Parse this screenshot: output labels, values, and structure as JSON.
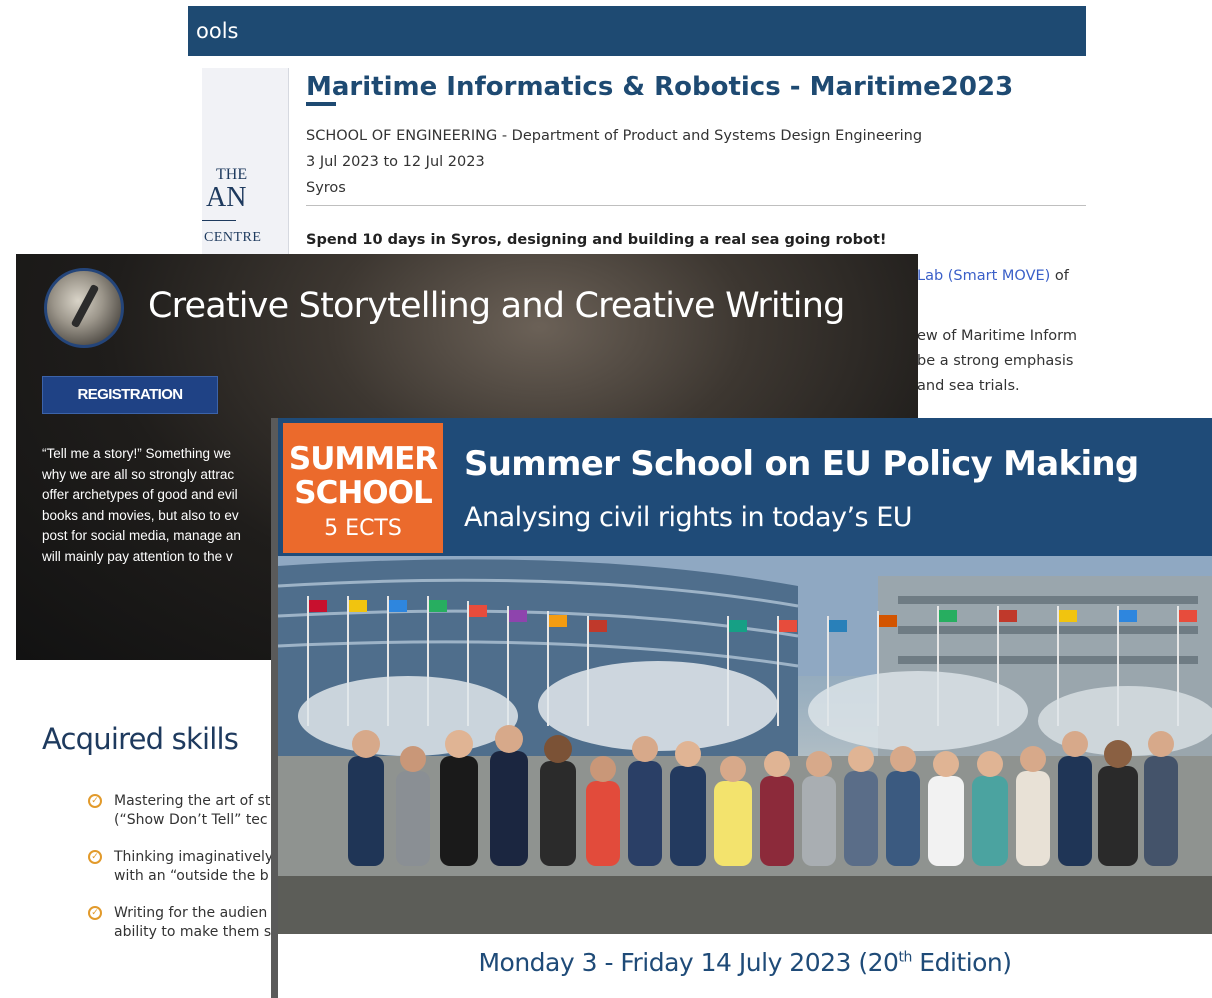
{
  "maritime": {
    "header_fragment": "ools",
    "logo": {
      "the": "THE",
      "an": "AN",
      "centre": "CENTRE"
    },
    "title": "Maritime Informatics & Robotics - Maritime2023",
    "school": "SCHOOL OF ENGINEERING - Department of Product and Systems Design Engineering",
    "dates": "3 Jul 2023 to 12 Jul 2023",
    "location": "Syros",
    "lead": "Spend 10 days in Syros, designing and building a real sea going robot!",
    "fragments": {
      "lab_link": "Lab (Smart MOVE)",
      "lab_after": " of",
      "line2": "ew of Maritime Inform",
      "line3": "be a strong emphasis",
      "line4": "and sea trials."
    }
  },
  "creative": {
    "title": "Creative Storytelling and Creative Writing",
    "registration_button": "REGISTRATION",
    "body_lines": [
      "“Tell me a story!” Something we",
      "why we are all so strongly attrac",
      "offer archetypes of good and evil",
      "books and movies, but also to ev",
      "post for social media, manage an",
      "will mainly pay attention to the v"
    ]
  },
  "skills": {
    "title": "Acquired skills",
    "items": [
      {
        "line1": "Mastering the art of st",
        "line2": "(“Show Don’t Tell” tec"
      },
      {
        "line1": "Thinking imaginatively",
        "line2": "with an “outside the b"
      },
      {
        "line1": "Writing for the audien",
        "line2": "ability to make them s"
      }
    ]
  },
  "eu": {
    "badge_line1": "SUMMER",
    "badge_line2": "SCHOOL",
    "badge_line3": "5 ECTS",
    "title": "Summer School on EU Policy Making",
    "subtitle": "Analysing civil rights in today’s EU",
    "footer_before": "Monday 3 - Friday 14 July 2023 (20",
    "footer_sup": "th",
    "footer_after": " Edition)"
  },
  "colors": {
    "navy": "#1e4a72",
    "eu_header": "#1f4b78",
    "badge_orange": "#eb6a2c",
    "check_orange": "#e29a2b",
    "link_blue": "#3a5fc8"
  }
}
